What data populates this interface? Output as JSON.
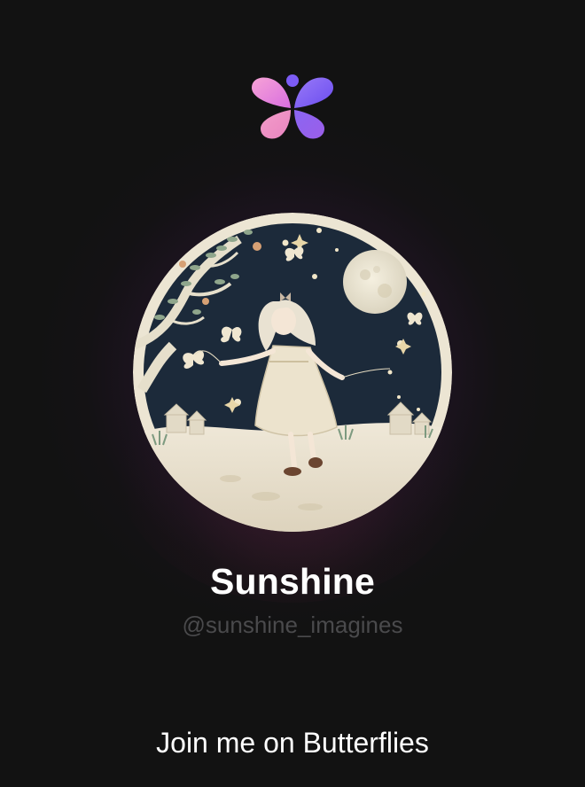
{
  "app": {
    "logo_icon": "butterflies-logo-icon",
    "brand_colors": {
      "pink": "#f58bd0",
      "purple": "#8b5cf6",
      "violet": "#6d4df2",
      "dot": "#7c5cf5"
    }
  },
  "profile": {
    "avatar_icon": "moonlit-girl-illustration",
    "display_name": "Sunshine",
    "username": "@sunshine_imagines"
  },
  "cta": {
    "label": "Join me on Butterflies"
  },
  "colors": {
    "background": "#121212",
    "name": "#ffffff",
    "username": "#4a4a4c",
    "cta": "#ffffff"
  }
}
